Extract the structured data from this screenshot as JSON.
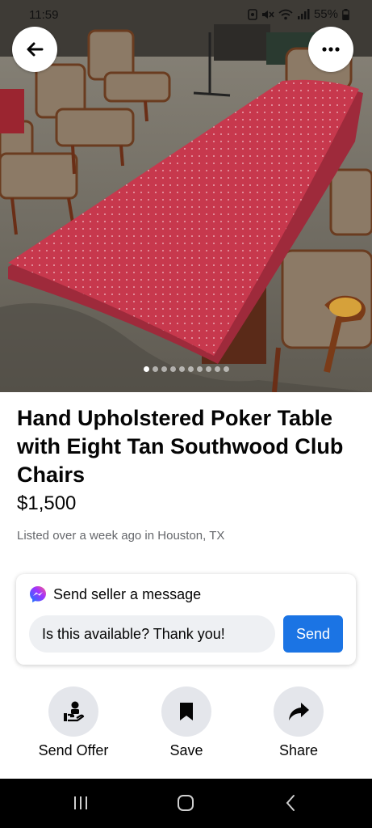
{
  "status_bar": {
    "time": "11:59",
    "battery": "55%",
    "icons": [
      "nfc-icon",
      "mute-icon",
      "wifi-icon",
      "signal-icon",
      "battery-icon"
    ]
  },
  "photo": {
    "current_index": 1,
    "total": 10,
    "description_icon": "listing-photo"
  },
  "listing": {
    "title": "Hand Upholstered Poker Table with Eight Tan Southwood Club Chairs",
    "price": "$1,500",
    "meta": "Listed over a week ago in Houston, TX"
  },
  "message": {
    "header": "Send seller a message",
    "input_value": "Is this available? Thank you!",
    "send_label": "Send"
  },
  "actions": {
    "send_offer": "Send Offer",
    "save": "Save",
    "share": "Share"
  },
  "colors": {
    "accent": "#1b74e4",
    "table_red": "#c23a4f",
    "action_bg": "#e4e6eb"
  }
}
